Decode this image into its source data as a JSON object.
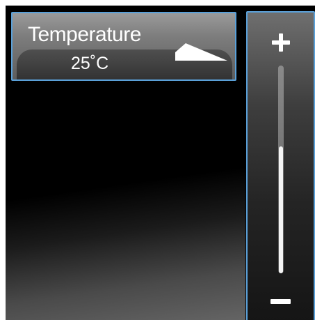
{
  "temperature_card": {
    "title": "Temperature",
    "value": "25˚C",
    "indicator_icon": "wedge-icon"
  },
  "slider": {
    "increase_icon": "plus-icon",
    "decrease_icon": "minus-icon",
    "level": 0.61
  },
  "colors": {
    "accent_border": "#5aa0d8",
    "text": "#ffffff",
    "background": "#000000"
  }
}
